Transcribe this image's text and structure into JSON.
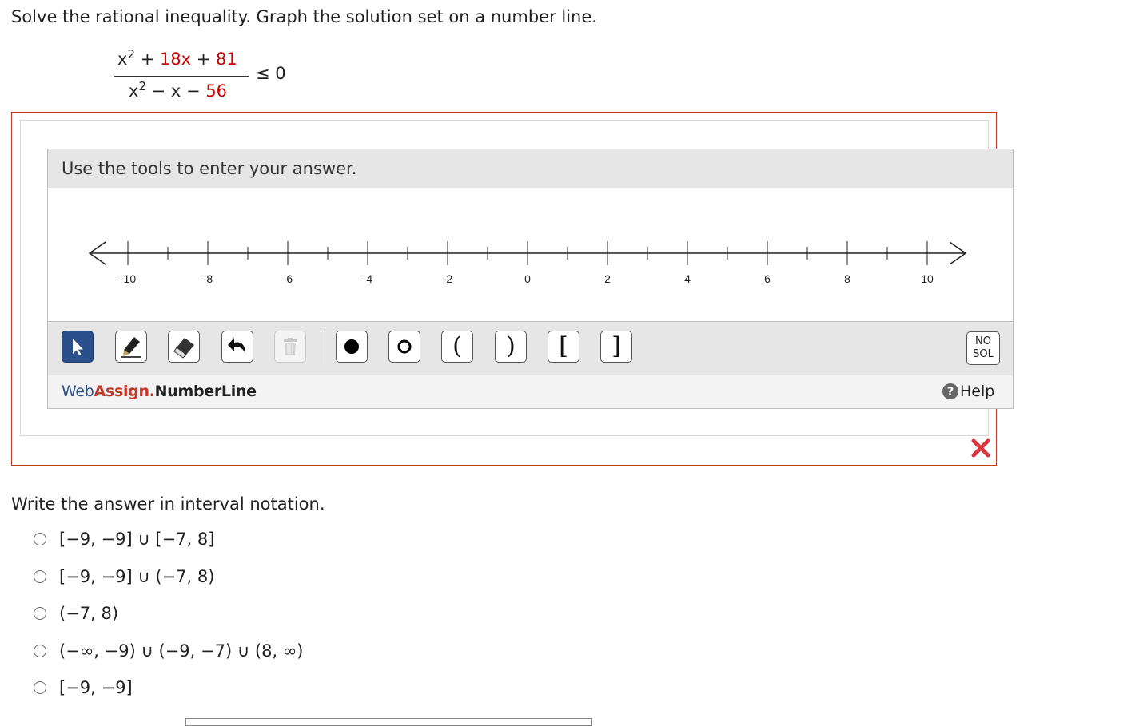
{
  "question": {
    "prompt": "Solve the rational inequality. Graph the solution set on a number line.",
    "numerator": {
      "x": "x",
      "exp": "2",
      "plus1": " + ",
      "term1": "18x",
      "plus2": " + ",
      "term2": "81"
    },
    "denominator": {
      "x": "x",
      "exp": "2",
      "minus1": " − x − ",
      "term2": "56"
    },
    "relation": "≤ 0"
  },
  "tool": {
    "header": "Use the tools to enter your answer.",
    "axis": {
      "min": -11,
      "max": 11,
      "tick_step": 1,
      "labels": [
        "-10",
        "-8",
        "-6",
        "-4",
        "-2",
        "0",
        "2",
        "4",
        "6",
        "8",
        "10"
      ]
    },
    "toolbar": {
      "open_paren": "(",
      "close_paren": ")",
      "open_bracket": "[",
      "close_bracket": "]",
      "no_sol_line1": "NO",
      "no_sol_line2": "SOL"
    },
    "brand_web": "Web",
    "brand_assign": "Assign",
    "brand_dot": ".",
    "brand_product": "NumberLine",
    "help": "Help",
    "help_icon": "?"
  },
  "part2": {
    "prompt": "Write the answer in interval notation.",
    "options": [
      "[−9, −9] ∪ [−7, 8]",
      "[−9, −9] ∪ (−7, 8)",
      "(−7, 8)",
      "(−∞, −9) ∪ (−9, −7) ∪ (8, ∞)",
      "[−9, −9]"
    ]
  },
  "colors": {
    "accent_red": "#cc0000",
    "brand_blue": "#2b4f8a",
    "box_border": "#c0392b"
  }
}
